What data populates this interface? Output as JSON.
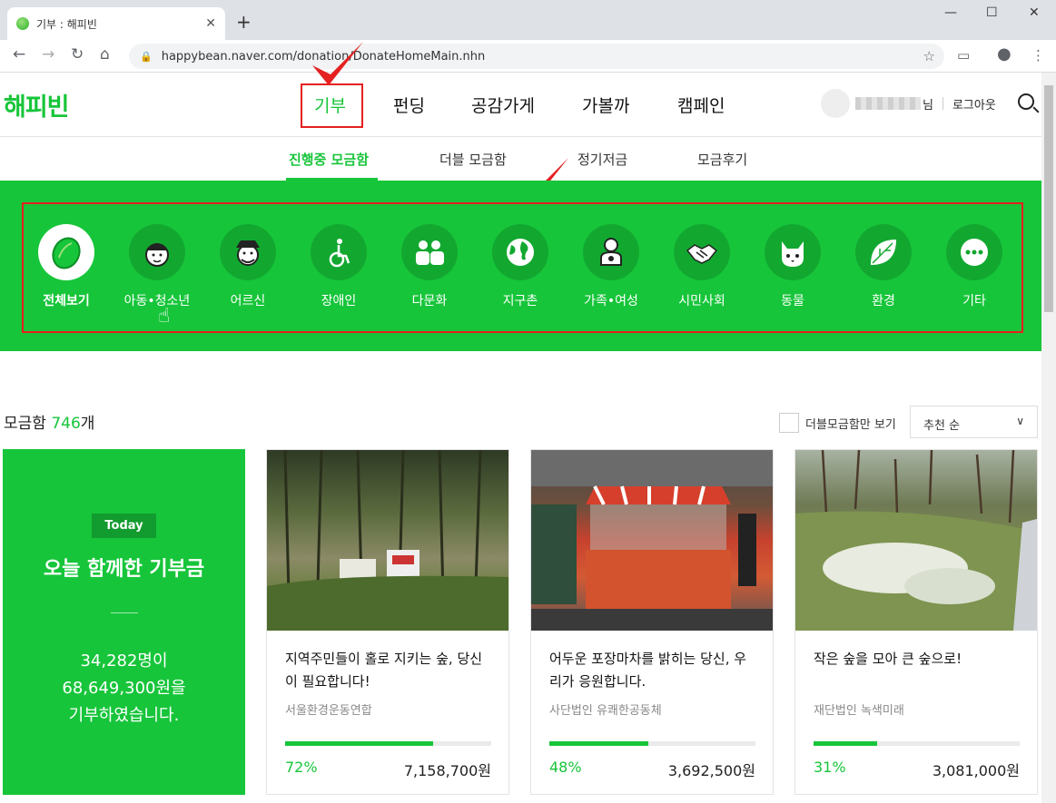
{
  "browser": {
    "tab_title": "기부 : 해피빈",
    "new_tab": "+",
    "url": "happybean.naver.com/donation/DonateHomeMain.nhn",
    "win_min": "—",
    "win_max": "☐",
    "win_close": "✕"
  },
  "header": {
    "logo": "해피빈",
    "gnb": [
      "기부",
      "펀딩",
      "공감가게",
      "가볼까",
      "캠페인"
    ],
    "user_suffix": "님",
    "logout": "로그아웃"
  },
  "subnav": [
    "진행중 모금함",
    "더블 모금함",
    "정기저금",
    "모금후기"
  ],
  "categories": [
    {
      "label": "전체보기",
      "icon": "bean-icon"
    },
    {
      "label": "아동•청소년",
      "icon": "child-icon"
    },
    {
      "label": "어르신",
      "icon": "elder-icon"
    },
    {
      "label": "장애인",
      "icon": "wheelchair-icon"
    },
    {
      "label": "다문화",
      "icon": "people-icon"
    },
    {
      "label": "지구촌",
      "icon": "globe-icon"
    },
    {
      "label": "가족•여성",
      "icon": "family-icon"
    },
    {
      "label": "시민사회",
      "icon": "handshake-icon"
    },
    {
      "label": "동물",
      "icon": "animal-icon"
    },
    {
      "label": "환경",
      "icon": "leaf-icon"
    },
    {
      "label": "기타",
      "icon": "more-icon"
    }
  ],
  "list": {
    "count_prefix": "모금함 ",
    "count": "746",
    "count_suffix": "개",
    "double_only": "더블모금함만 보기",
    "sort": "추천 순"
  },
  "today": {
    "badge": "Today",
    "title": "오늘 함께한 기부금",
    "line1": "34,282명이",
    "line2": "68,649,300원을",
    "line3": "기부하였습니다."
  },
  "cards": [
    {
      "title": "지역주민들이 홀로 지키는 숲, 당신이 필요합니다!",
      "org": "서울환경운동연합",
      "percent": "72%",
      "progress": 0.72,
      "amount": "7,158,700원"
    },
    {
      "title": "어두운 포장마차를 밝히는 당신, 우리가 응원합니다.",
      "org": "사단법인 유쾌한공동체",
      "percent": "48%",
      "progress": 0.48,
      "amount": "3,692,500원"
    },
    {
      "title": "작은 숲을 모아 큰 숲으로!",
      "org": "재단법인 녹색미래",
      "percent": "31%",
      "progress": 0.31,
      "amount": "3,081,000원"
    }
  ]
}
